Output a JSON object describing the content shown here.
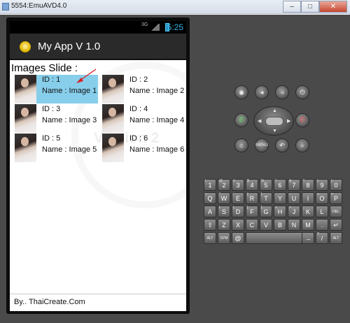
{
  "window": {
    "title": "5554:EmuAVD4.0",
    "minimize_glyph": "–",
    "maximize_glyph": "□",
    "close_glyph": "✕"
  },
  "statusbar": {
    "time": "5:25",
    "network_label": "3G"
  },
  "actionbar": {
    "title": "My App V 1.0",
    "icon": "clock-icon"
  },
  "content": {
    "header": "Images Slide :",
    "watermark": "Version 2",
    "items": [
      {
        "id": "ID : 1",
        "name": "Name : Image 1",
        "selected": true
      },
      {
        "id": "ID : 2",
        "name": "Name : Image 2",
        "selected": false
      },
      {
        "id": "ID : 3",
        "name": "Name : Image 3",
        "selected": false
      },
      {
        "id": "ID : 4",
        "name": "Name : Image 4",
        "selected": false
      },
      {
        "id": "ID : 5",
        "name": "Name : Image 5",
        "selected": false
      },
      {
        "id": "ID : 6",
        "name": "Name : Image 6",
        "selected": false
      }
    ],
    "footer": "By.. ThaiCreate.Com"
  },
  "controls": {
    "row1": [
      "camera-icon",
      "volume-down-icon",
      "volume-up-icon",
      "power-icon"
    ],
    "call_icon": "call-icon",
    "end_call_icon": "end-call-icon",
    "row3": [
      "home-icon",
      "menu-icon",
      "back-icon",
      "search-icon"
    ],
    "menu_label": "MENU",
    "selected_color": "#87ceeb"
  },
  "keyboard": {
    "row1": [
      [
        "1",
        "!"
      ],
      [
        "2",
        "@"
      ],
      [
        "3",
        "#"
      ],
      [
        "4",
        "$"
      ],
      [
        "5",
        "%"
      ],
      [
        "6",
        "^"
      ],
      [
        "7",
        "&"
      ],
      [
        "8",
        "*"
      ],
      [
        "9",
        "("
      ],
      [
        "0",
        ")"
      ]
    ],
    "row2": [
      [
        "Q",
        "~"
      ],
      [
        "W",
        "\""
      ],
      [
        "E",
        "`"
      ],
      [
        "R",
        "{"
      ],
      [
        "T",
        "}"
      ],
      [
        "Y",
        ""
      ],
      [
        "U",
        "-"
      ],
      [
        "I",
        ""
      ],
      [
        "O",
        "+"
      ],
      [
        "P",
        "="
      ]
    ],
    "row3": [
      [
        "A",
        ""
      ],
      [
        "S",
        "\\"
      ],
      [
        "D",
        "|"
      ],
      [
        "F",
        "["
      ],
      [
        "G",
        "]"
      ],
      [
        "H",
        "<"
      ],
      [
        "J",
        ">"
      ],
      [
        "K",
        ";"
      ],
      [
        "L",
        ":"
      ],
      [
        "DEL",
        ""
      ]
    ],
    "row4": [
      [
        "⇧",
        ""
      ],
      [
        "Z",
        ""
      ],
      [
        "X",
        ""
      ],
      [
        "C",
        ""
      ],
      [
        "V",
        ""
      ],
      [
        "B",
        ""
      ],
      [
        "N",
        ""
      ],
      [
        "M",
        ""
      ],
      [
        ".",
        ""
      ],
      [
        "↵",
        ""
      ]
    ],
    "row5_left": [
      "ALT",
      "SYM",
      "@"
    ],
    "row5_right": [
      [
        "→",
        ""
      ],
      [
        "/",
        "?"
      ],
      [
        ",",
        ""
      ],
      [
        "ALT",
        ""
      ]
    ]
  }
}
